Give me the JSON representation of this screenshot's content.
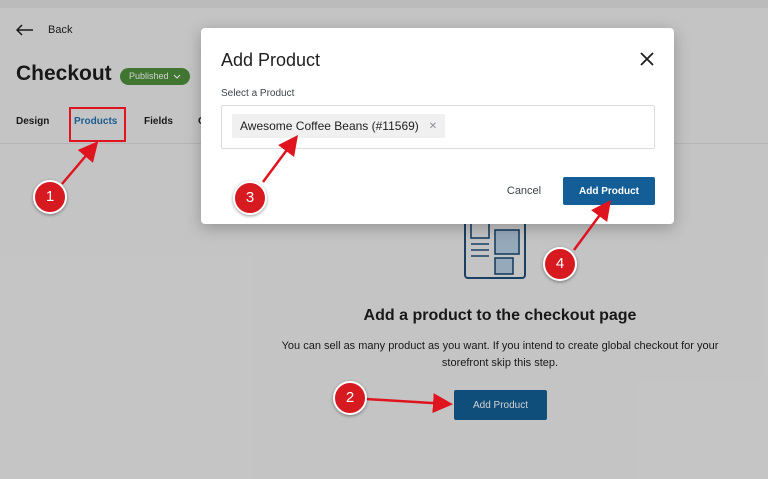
{
  "header": {
    "back_label": "Back",
    "page_title": "Checkout",
    "status_badge": "Published"
  },
  "tabs": [
    {
      "label": "Design"
    },
    {
      "label": "Products",
      "active": true
    },
    {
      "label": "Fields"
    },
    {
      "label": "O"
    }
  ],
  "empty_state": {
    "title": "Add a product to the checkout page",
    "description": "You can sell as many product as you want. If you intend to create global checkout for your storefront skip this step.",
    "button_label": "Add Product"
  },
  "modal": {
    "title": "Add Product",
    "select_label": "Select a Product",
    "selected_product": "Awesome Coffee Beans (#11569)",
    "cancel_label": "Cancel",
    "add_label": "Add Product"
  },
  "annotations": {
    "steps": [
      "1",
      "2",
      "3",
      "4"
    ],
    "color": "#d71920"
  },
  "colors": {
    "primary_button": "#135e96",
    "active_tab": "#2271b1",
    "badge": "#4f8f3d"
  }
}
